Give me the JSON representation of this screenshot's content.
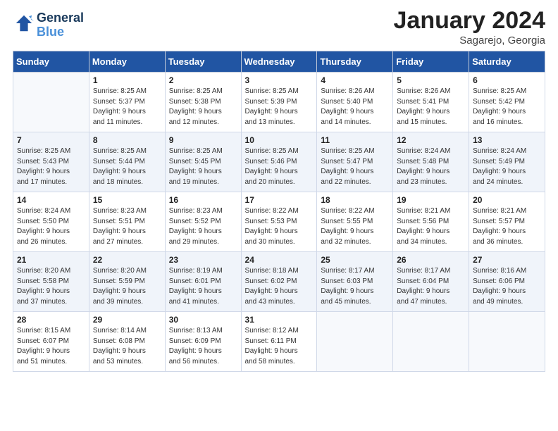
{
  "logo": {
    "text1": "General",
    "text2": "Blue"
  },
  "title": "January 2024",
  "location": "Sagarejo, Georgia",
  "days_of_week": [
    "Sunday",
    "Monday",
    "Tuesday",
    "Wednesday",
    "Thursday",
    "Friday",
    "Saturday"
  ],
  "weeks": [
    [
      {
        "num": "",
        "info": ""
      },
      {
        "num": "1",
        "info": "Sunrise: 8:25 AM\nSunset: 5:37 PM\nDaylight: 9 hours\nand 11 minutes."
      },
      {
        "num": "2",
        "info": "Sunrise: 8:25 AM\nSunset: 5:38 PM\nDaylight: 9 hours\nand 12 minutes."
      },
      {
        "num": "3",
        "info": "Sunrise: 8:25 AM\nSunset: 5:39 PM\nDaylight: 9 hours\nand 13 minutes."
      },
      {
        "num": "4",
        "info": "Sunrise: 8:26 AM\nSunset: 5:40 PM\nDaylight: 9 hours\nand 14 minutes."
      },
      {
        "num": "5",
        "info": "Sunrise: 8:26 AM\nSunset: 5:41 PM\nDaylight: 9 hours\nand 15 minutes."
      },
      {
        "num": "6",
        "info": "Sunrise: 8:25 AM\nSunset: 5:42 PM\nDaylight: 9 hours\nand 16 minutes."
      }
    ],
    [
      {
        "num": "7",
        "info": "Sunrise: 8:25 AM\nSunset: 5:43 PM\nDaylight: 9 hours\nand 17 minutes."
      },
      {
        "num": "8",
        "info": "Sunrise: 8:25 AM\nSunset: 5:44 PM\nDaylight: 9 hours\nand 18 minutes."
      },
      {
        "num": "9",
        "info": "Sunrise: 8:25 AM\nSunset: 5:45 PM\nDaylight: 9 hours\nand 19 minutes."
      },
      {
        "num": "10",
        "info": "Sunrise: 8:25 AM\nSunset: 5:46 PM\nDaylight: 9 hours\nand 20 minutes."
      },
      {
        "num": "11",
        "info": "Sunrise: 8:25 AM\nSunset: 5:47 PM\nDaylight: 9 hours\nand 22 minutes."
      },
      {
        "num": "12",
        "info": "Sunrise: 8:24 AM\nSunset: 5:48 PM\nDaylight: 9 hours\nand 23 minutes."
      },
      {
        "num": "13",
        "info": "Sunrise: 8:24 AM\nSunset: 5:49 PM\nDaylight: 9 hours\nand 24 minutes."
      }
    ],
    [
      {
        "num": "14",
        "info": "Sunrise: 8:24 AM\nSunset: 5:50 PM\nDaylight: 9 hours\nand 26 minutes."
      },
      {
        "num": "15",
        "info": "Sunrise: 8:23 AM\nSunset: 5:51 PM\nDaylight: 9 hours\nand 27 minutes."
      },
      {
        "num": "16",
        "info": "Sunrise: 8:23 AM\nSunset: 5:52 PM\nDaylight: 9 hours\nand 29 minutes."
      },
      {
        "num": "17",
        "info": "Sunrise: 8:22 AM\nSunset: 5:53 PM\nDaylight: 9 hours\nand 30 minutes."
      },
      {
        "num": "18",
        "info": "Sunrise: 8:22 AM\nSunset: 5:55 PM\nDaylight: 9 hours\nand 32 minutes."
      },
      {
        "num": "19",
        "info": "Sunrise: 8:21 AM\nSunset: 5:56 PM\nDaylight: 9 hours\nand 34 minutes."
      },
      {
        "num": "20",
        "info": "Sunrise: 8:21 AM\nSunset: 5:57 PM\nDaylight: 9 hours\nand 36 minutes."
      }
    ],
    [
      {
        "num": "21",
        "info": "Sunrise: 8:20 AM\nSunset: 5:58 PM\nDaylight: 9 hours\nand 37 minutes."
      },
      {
        "num": "22",
        "info": "Sunrise: 8:20 AM\nSunset: 5:59 PM\nDaylight: 9 hours\nand 39 minutes."
      },
      {
        "num": "23",
        "info": "Sunrise: 8:19 AM\nSunset: 6:01 PM\nDaylight: 9 hours\nand 41 minutes."
      },
      {
        "num": "24",
        "info": "Sunrise: 8:18 AM\nSunset: 6:02 PM\nDaylight: 9 hours\nand 43 minutes."
      },
      {
        "num": "25",
        "info": "Sunrise: 8:17 AM\nSunset: 6:03 PM\nDaylight: 9 hours\nand 45 minutes."
      },
      {
        "num": "26",
        "info": "Sunrise: 8:17 AM\nSunset: 6:04 PM\nDaylight: 9 hours\nand 47 minutes."
      },
      {
        "num": "27",
        "info": "Sunrise: 8:16 AM\nSunset: 6:06 PM\nDaylight: 9 hours\nand 49 minutes."
      }
    ],
    [
      {
        "num": "28",
        "info": "Sunrise: 8:15 AM\nSunset: 6:07 PM\nDaylight: 9 hours\nand 51 minutes."
      },
      {
        "num": "29",
        "info": "Sunrise: 8:14 AM\nSunset: 6:08 PM\nDaylight: 9 hours\nand 53 minutes."
      },
      {
        "num": "30",
        "info": "Sunrise: 8:13 AM\nSunset: 6:09 PM\nDaylight: 9 hours\nand 56 minutes."
      },
      {
        "num": "31",
        "info": "Sunrise: 8:12 AM\nSunset: 6:11 PM\nDaylight: 9 hours\nand 58 minutes."
      },
      {
        "num": "",
        "info": ""
      },
      {
        "num": "",
        "info": ""
      },
      {
        "num": "",
        "info": ""
      }
    ]
  ]
}
